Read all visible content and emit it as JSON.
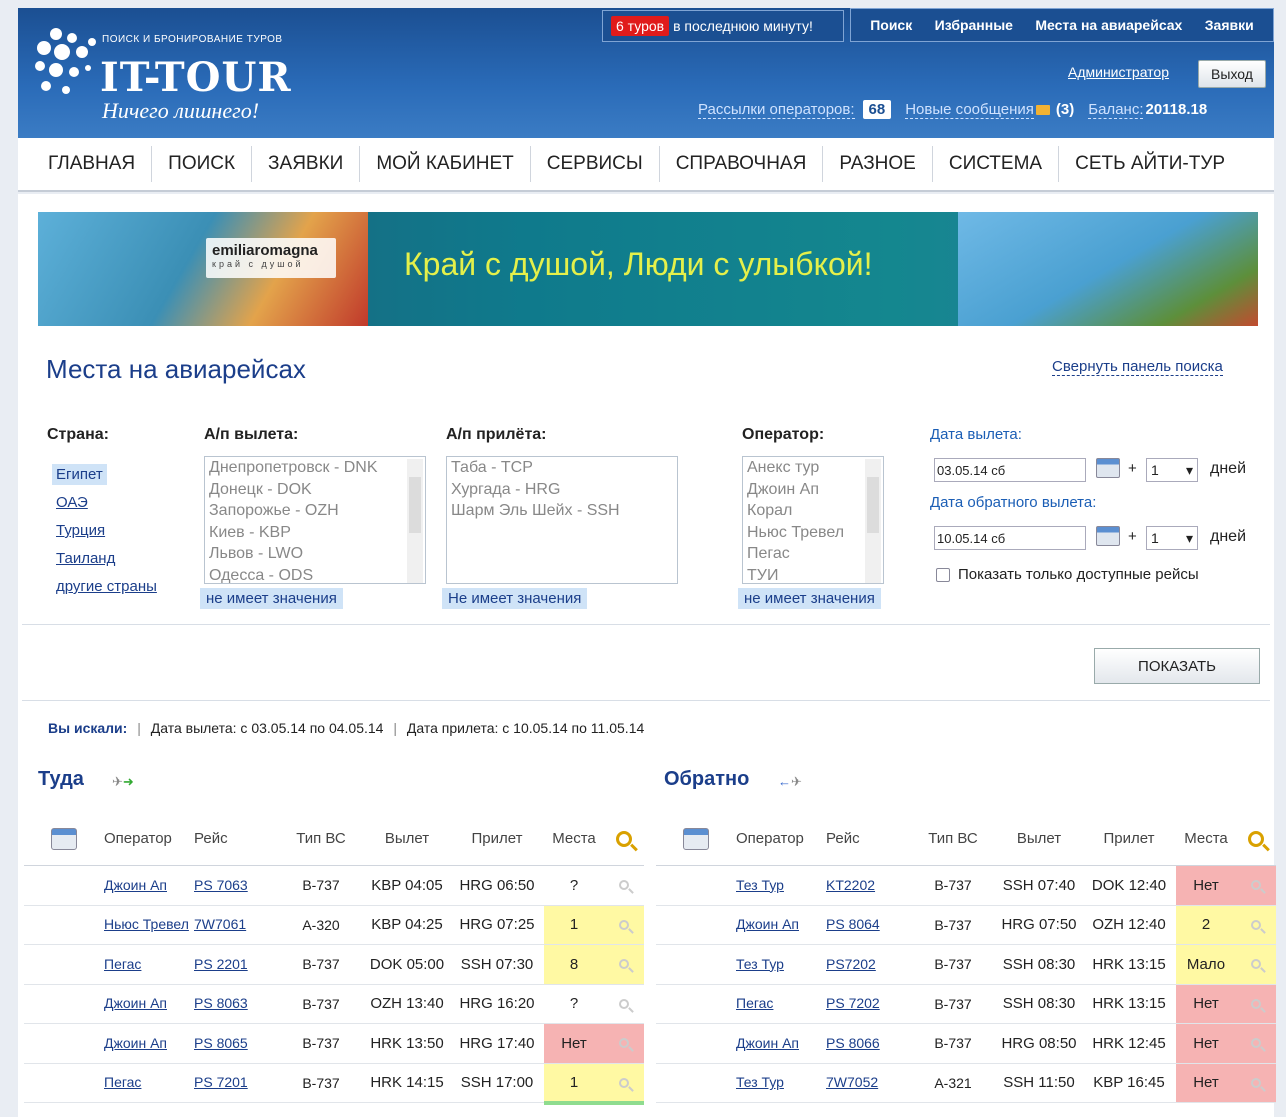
{
  "header": {
    "logo_sub": "ПОИСК И БРОНИРОВАНИЕ ТУРОВ",
    "logo_main": "IT-TOUR",
    "logo_slogan": "Ничего лишнего!",
    "hot_count": "6 туров",
    "hot_text": "в последнюю минуту!",
    "topnav": [
      "Поиск",
      "Избранные",
      "Места на авиарейсах",
      "Заявки"
    ],
    "admin_label": "Администратор",
    "logout_label": "Выход",
    "mailings_label": "Рассылки операторов:",
    "mailings_count": "68",
    "messages_label": "Новые сообщения",
    "messages_count": "(3)",
    "balance_label": "Баланс:",
    "balance_value": "20118.18"
  },
  "mainnav": [
    "ГЛАВНАЯ",
    "ПОИСК",
    "ЗАЯВКИ",
    "МОЙ КАБИНЕТ",
    "СЕРВИСЫ",
    "СПРАВОЧНАЯ",
    "РАЗНОЕ",
    "СИСТЕМА",
    "СЕТЬ АЙТИ-ТУР"
  ],
  "banner": {
    "brand": "emiliaromagna",
    "brand_sub": "край с душой",
    "slogan": "Край с душой, Люди с улыбкой!"
  },
  "page": {
    "title": "Места на авиарейсах",
    "collapse_label": "Свернуть панель поиска"
  },
  "filters": {
    "country_label": "Страна:",
    "countries": [
      "Египет",
      "ОАЭ",
      "Турция",
      "Таиланд",
      "другие страны"
    ],
    "departure_label": "А/п вылета:",
    "departure_airports": [
      "Днепропетровск - DNK",
      "Донецк - DOK",
      "Запорожье - OZH",
      "Киев - KBP",
      "Львов - LWO",
      "Одесса - ODS"
    ],
    "departure_tag": "не имеет значения",
    "arrival_label": "А/п прилёта:",
    "arrival_airports": [
      "Таба - TCP",
      "Хургада - HRG",
      "Шарм Эль Шейх - SSH"
    ],
    "arrival_tag": "Не имеет значения",
    "operator_label": "Оператор:",
    "operators": [
      "Анекс тур",
      "Джоин Ап",
      "Корал",
      "Ньюс Тревел",
      "Пегас",
      "ТУИ"
    ],
    "operator_tag": "не имеет значения",
    "dep_date_label": "Дата вылета:",
    "dep_date": "03.05.14 сб",
    "return_date_label": "Дата обратного вылета:",
    "return_date": "10.05.14 сб",
    "plus": "+",
    "days_value": "1",
    "days_label": "дней",
    "only_available": "Показать только доступные рейсы",
    "show_button": "ПОКАЗАТЬ"
  },
  "searched": {
    "label": "Вы искали:",
    "departure": "Дата вылета: с 03.05.14 по 04.05.14",
    "arrival": "Дата прилета: с 10.05.14 по 11.05.14"
  },
  "columns": [
    "Оператор",
    "Рейс",
    "Тип ВС",
    "Вылет",
    "Прилет",
    "Места"
  ],
  "outbound": {
    "title": "Туда",
    "rows": [
      {
        "operator": "Джоин Ап",
        "flight": "PS 7063",
        "aircraft": "B-737",
        "dep": "KBP 04:05",
        "arr": "HRG 06:50",
        "seats": "?",
        "status": "none"
      },
      {
        "operator": "Ньюс Тревел",
        "flight": "7W7061",
        "aircraft": "A-320",
        "dep": "KBP 04:25",
        "arr": "HRG 07:25",
        "seats": "1",
        "status": "yellow"
      },
      {
        "operator": "Пегас",
        "flight": "PS 2201",
        "aircraft": "B-737",
        "dep": "DOK 05:00",
        "arr": "SSH 07:30",
        "seats": "8",
        "status": "yellow"
      },
      {
        "operator": "Джоин Ап",
        "flight": "PS 8063",
        "aircraft": "B-737",
        "dep": "OZH 13:40",
        "arr": "HRG 16:20",
        "seats": "?",
        "status": "none"
      },
      {
        "operator": "Джоин Ап",
        "flight": "PS 8065",
        "aircraft": "B-737",
        "dep": "HRK 13:50",
        "arr": "HRG 17:40",
        "seats": "Нет",
        "status": "red"
      },
      {
        "operator": "Пегас",
        "flight": "PS 7201",
        "aircraft": "B-737",
        "dep": "HRK 14:15",
        "arr": "SSH 17:00",
        "seats": "1",
        "status": "yellow"
      }
    ]
  },
  "inbound": {
    "title": "Обратно",
    "rows": [
      {
        "operator": "Тез Тур",
        "flight": "KT2202",
        "aircraft": "B-737",
        "dep": "SSH 07:40",
        "arr": "DOK 12:40",
        "seats": "Нет",
        "status": "red"
      },
      {
        "operator": "Джоин Ап",
        "flight": "PS 8064",
        "aircraft": "B-737",
        "dep": "HRG 07:50",
        "arr": "OZH 12:40",
        "seats": "2",
        "status": "yellow"
      },
      {
        "operator": "Тез Тур",
        "flight": "PS7202",
        "aircraft": "B-737",
        "dep": "SSH 08:30",
        "arr": "HRK 13:15",
        "seats": "Мало",
        "status": "yellow"
      },
      {
        "operator": "Пегас",
        "flight": "PS 7202",
        "aircraft": "B-737",
        "dep": "SSH 08:30",
        "arr": "HRK 13:15",
        "seats": "Нет",
        "status": "red"
      },
      {
        "operator": "Джоин Ап",
        "flight": "PS 8066",
        "aircraft": "B-737",
        "dep": "HRG 08:50",
        "arr": "HRK 12:45",
        "seats": "Нет",
        "status": "red"
      },
      {
        "operator": "Тез Тур",
        "flight": "7W7052",
        "aircraft": "A-321",
        "dep": "SSH 11:50",
        "arr": "KBP 16:45",
        "seats": "Нет",
        "status": "red"
      }
    ]
  }
}
